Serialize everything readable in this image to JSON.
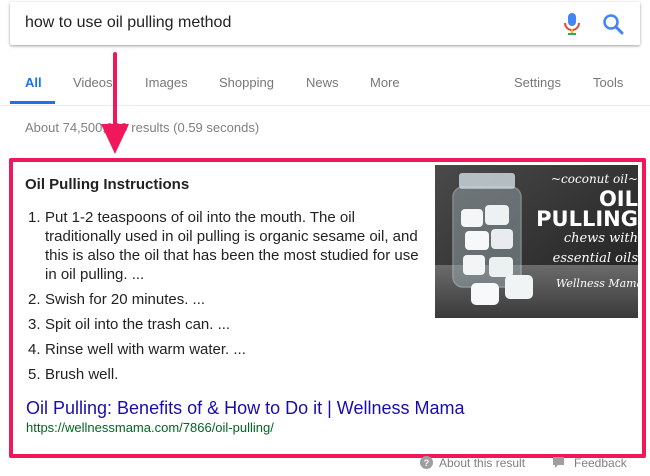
{
  "search": {
    "query": "how to use oil pulling method"
  },
  "tabs": [
    {
      "label": "All",
      "active": true
    },
    {
      "label": "Videos",
      "active": false
    },
    {
      "label": "Images",
      "active": false
    },
    {
      "label": "Shopping",
      "active": false
    },
    {
      "label": "News",
      "active": false
    },
    {
      "label": "More",
      "active": false
    },
    {
      "label": "Settings",
      "active": false
    },
    {
      "label": "Tools",
      "active": false
    }
  ],
  "result_stats": "About 74,500,000 results (0.59 seconds)",
  "snippet": {
    "title": "Oil Pulling Instructions",
    "steps": [
      {
        "num": "1.",
        "text": "Put 1-2 teaspoons of oil into the mouth. The oil traditionally used in oil pulling is organic sesame oil, and this is also the oil that has been the most studied for use in oil pulling. ..."
      },
      {
        "num": "2.",
        "text": "Swish for 20 minutes. ..."
      },
      {
        "num": "3.",
        "text": "Spit oil into the trash can. ..."
      },
      {
        "num": "4.",
        "text": "Rinse well with warm water. ..."
      },
      {
        "num": "5.",
        "text": "Brush well."
      }
    ],
    "image": {
      "caption_line1": "~coconut oil~",
      "caption_line2": "OIL PULLING",
      "caption_line3": "chews with",
      "caption_line4": "essential oils",
      "brand": "Wellness Mama"
    },
    "link_title": "Oil Pulling: Benefits of & How to Do it | Wellness Mama",
    "url": "https://wellnessmama.com/7866/oil-pulling/"
  },
  "footer": {
    "about": "About this result",
    "feedback": "Feedback"
  },
  "colors": {
    "accent_blue": "#1a73e8",
    "link_blue": "#1a0dab",
    "url_green": "#006621",
    "highlight_pink": "#f0185a"
  }
}
